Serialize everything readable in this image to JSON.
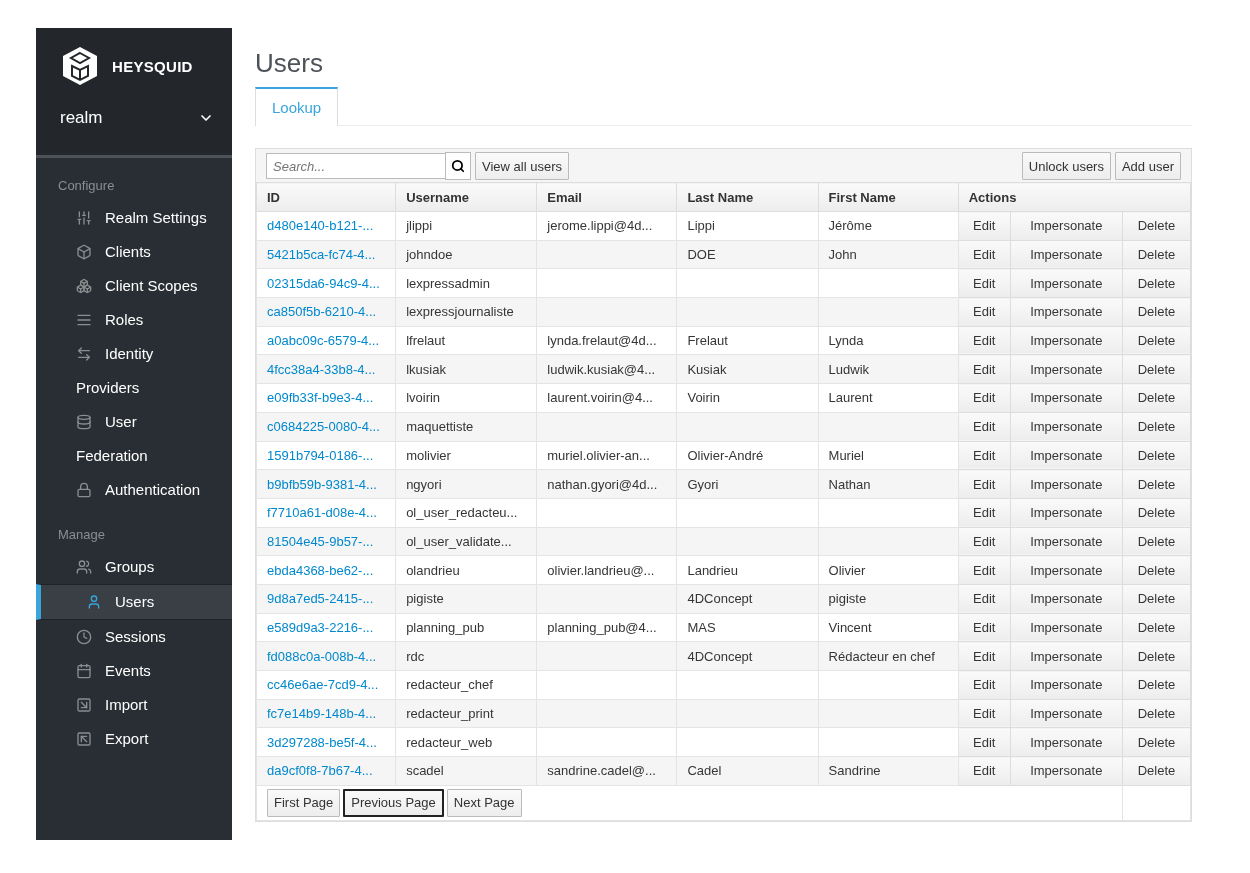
{
  "sidebar": {
    "brand": "HEYSQUID",
    "realm": "realm",
    "sections": [
      {
        "heading": "Configure",
        "items": [
          {
            "label": "Realm Settings",
            "selected": false
          },
          {
            "label": "Clients",
            "selected": false
          },
          {
            "label": "Client Scopes",
            "selected": false
          },
          {
            "label": "Roles",
            "selected": false
          },
          {
            "label": "Identity Providers",
            "selected": false
          },
          {
            "label": "User Federation",
            "selected": false
          },
          {
            "label": "Authentication",
            "selected": false
          }
        ]
      },
      {
        "heading": "Manage",
        "items": [
          {
            "label": "Groups",
            "selected": false
          },
          {
            "label": "Users",
            "selected": true
          },
          {
            "label": "Sessions",
            "selected": false
          },
          {
            "label": "Events",
            "selected": false
          },
          {
            "label": "Import",
            "selected": false
          },
          {
            "label": "Export",
            "selected": false
          }
        ]
      }
    ]
  },
  "page_title": "Users",
  "tabs": [
    {
      "label": "Lookup",
      "selected": true
    }
  ],
  "toolbar": {
    "search": {
      "placeholder": "Search..."
    },
    "view_all": "View all users",
    "right_buttons": [
      "Unlock users",
      "Add user"
    ]
  },
  "table": {
    "columns": [
      "ID",
      "Username",
      "Email",
      "Last Name",
      "First Name",
      "Actions"
    ],
    "rows": [
      {
        "id": "d480e140-b121-...",
        "username": "jlippi",
        "email": "jerome.lippi@4d...",
        "last_name": "Lippi",
        "first_name": "Jérôme",
        "actions": [
          "Edit",
          "Impersonate",
          "Delete"
        ]
      },
      {
        "id": "5421b5ca-fc74-4...",
        "username": "johndoe",
        "email": "",
        "last_name": "DOE",
        "first_name": "John",
        "actions": [
          "Edit",
          "Impersonate",
          "Delete"
        ]
      },
      {
        "id": "02315da6-94c9-4...",
        "username": "lexpressadmin",
        "email": "",
        "last_name": "",
        "first_name": "",
        "actions": [
          "Edit",
          "Impersonate",
          "Delete"
        ]
      },
      {
        "id": "ca850f5b-6210-4...",
        "username": "lexpressjournaliste",
        "email": "",
        "last_name": "",
        "first_name": "",
        "actions": [
          "Edit",
          "Impersonate",
          "Delete"
        ]
      },
      {
        "id": "a0abc09c-6579-4...",
        "username": "lfrelaut",
        "email": "lynda.frelaut@4d...",
        "last_name": "Frelaut",
        "first_name": "Lynda",
        "actions": [
          "Edit",
          "Impersonate",
          "Delete"
        ]
      },
      {
        "id": "4fcc38a4-33b8-4...",
        "username": "lkusiak",
        "email": "ludwik.kusiak@4...",
        "last_name": "Kusiak",
        "first_name": "Ludwik",
        "actions": [
          "Edit",
          "Impersonate",
          "Delete"
        ]
      },
      {
        "id": "e09fb33f-b9e3-4...",
        "username": "lvoirin",
        "email": "laurent.voirin@4...",
        "last_name": "Voirin",
        "first_name": "Laurent",
        "actions": [
          "Edit",
          "Impersonate",
          "Delete"
        ]
      },
      {
        "id": "c0684225-0080-4...",
        "username": "maquettiste",
        "email": "",
        "last_name": "",
        "first_name": "",
        "actions": [
          "Edit",
          "Impersonate",
          "Delete"
        ]
      },
      {
        "id": "1591b794-0186-...",
        "username": "molivier",
        "email": "muriel.olivier-an...",
        "last_name": "Olivier-André",
        "first_name": "Muriel",
        "actions": [
          "Edit",
          "Impersonate",
          "Delete"
        ]
      },
      {
        "id": "b9bfb59b-9381-4...",
        "username": "ngyori",
        "email": "nathan.gyori@4d...",
        "last_name": "Gyori",
        "first_name": "Nathan",
        "actions": [
          "Edit",
          "Impersonate",
          "Delete"
        ]
      },
      {
        "id": "f7710a61-d08e-4...",
        "username": "ol_user_redacteu...",
        "email": "",
        "last_name": "",
        "first_name": "",
        "actions": [
          "Edit",
          "Impersonate",
          "Delete"
        ]
      },
      {
        "id": "81504e45-9b57-...",
        "username": "ol_user_validate...",
        "email": "",
        "last_name": "",
        "first_name": "",
        "actions": [
          "Edit",
          "Impersonate",
          "Delete"
        ]
      },
      {
        "id": "ebda4368-be62-...",
        "username": "olandrieu",
        "email": "olivier.landrieu@...",
        "last_name": "Landrieu",
        "first_name": "Olivier",
        "actions": [
          "Edit",
          "Impersonate",
          "Delete"
        ]
      },
      {
        "id": "9d8a7ed5-2415-...",
        "username": "pigiste",
        "email": "",
        "last_name": "4DConcept",
        "first_name": "pigiste",
        "actions": [
          "Edit",
          "Impersonate",
          "Delete"
        ]
      },
      {
        "id": "e589d9a3-2216-...",
        "username": "planning_pub",
        "email": "planning_pub@4...",
        "last_name": "MAS",
        "first_name": "Vincent",
        "actions": [
          "Edit",
          "Impersonate",
          "Delete"
        ]
      },
      {
        "id": "fd088c0a-008b-4...",
        "username": "rdc",
        "email": "",
        "last_name": "4DConcept",
        "first_name": "Rédacteur en chef",
        "actions": [
          "Edit",
          "Impersonate",
          "Delete"
        ]
      },
      {
        "id": "cc46e6ae-7cd9-4...",
        "username": "redacteur_chef",
        "email": "",
        "last_name": "",
        "first_name": "",
        "actions": [
          "Edit",
          "Impersonate",
          "Delete"
        ]
      },
      {
        "id": "fc7e14b9-148b-4...",
        "username": "redacteur_print",
        "email": "",
        "last_name": "",
        "first_name": "",
        "actions": [
          "Edit",
          "Impersonate",
          "Delete"
        ]
      },
      {
        "id": "3d297288-be5f-4...",
        "username": "redacteur_web",
        "email": "",
        "last_name": "",
        "first_name": "",
        "actions": [
          "Edit",
          "Impersonate",
          "Delete"
        ]
      },
      {
        "id": "da9cf0f8-7b67-4...",
        "username": "scadel",
        "email": "sandrine.cadel@...",
        "last_name": "Cadel",
        "first_name": "Sandrine",
        "actions": [
          "Edit",
          "Impersonate",
          "Delete"
        ]
      }
    ]
  },
  "pagination": [
    {
      "label": "First Page",
      "focused": false
    },
    {
      "label": "Previous Page",
      "focused": true
    },
    {
      "label": "Next Page",
      "focused": false
    }
  ]
}
